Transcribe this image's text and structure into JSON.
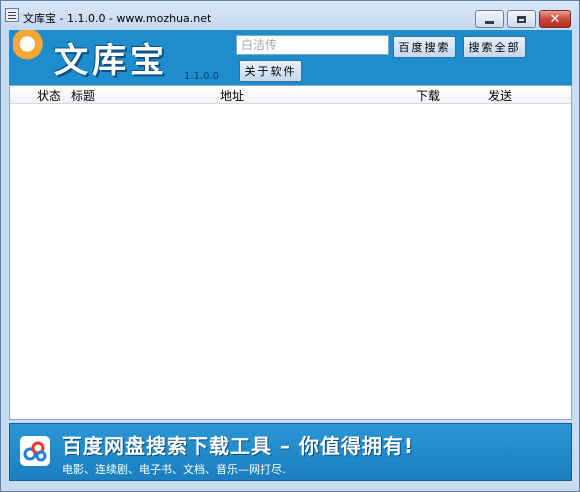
{
  "window": {
    "title": "文库宝 - 1.1.0.0 - www.mozhua.net",
    "close_symbol": "✕"
  },
  "header": {
    "logo_text": "文库宝",
    "version": "1.1.0.0",
    "search": {
      "value": "",
      "placeholder": "白洁传"
    },
    "buttons": [
      "百度搜索",
      "搜索全部",
      "关于软件"
    ]
  },
  "table": {
    "columns": [
      "状态",
      "标题",
      "地址",
      "下载",
      "发送"
    ],
    "rows": []
  },
  "banner": {
    "title": "百度网盘搜索下载工具 – 你值得拥有!",
    "subtitle": "电影、连续剧、电子书、文档、音乐—网打尽."
  },
  "colors": {
    "header_blue": "#1e8dce",
    "window_frame": "#c9dcf1",
    "close_red": "#c8473a"
  }
}
